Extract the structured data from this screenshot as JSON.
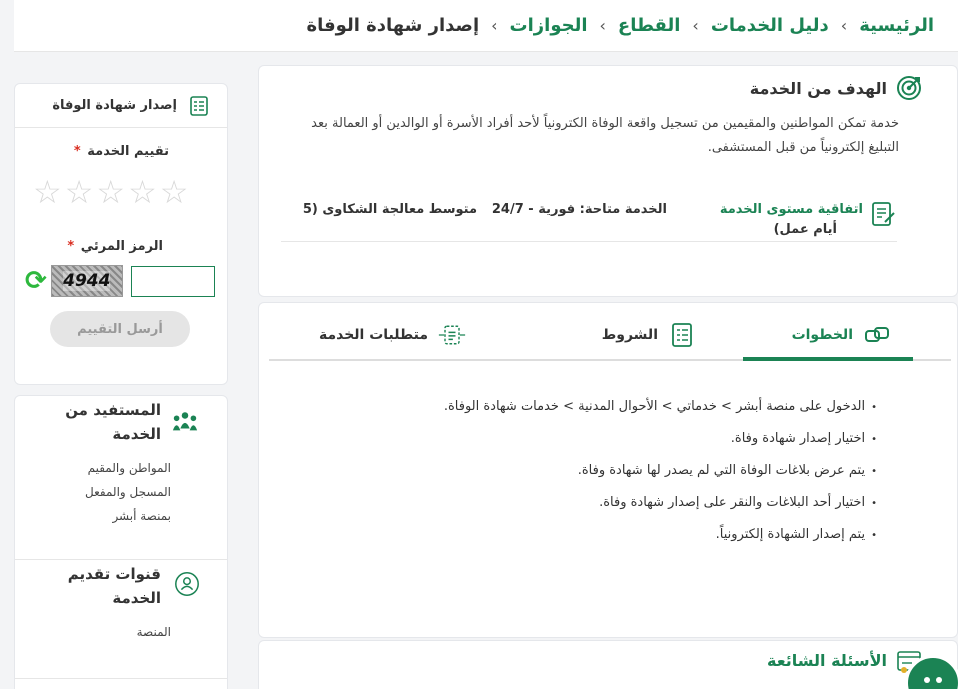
{
  "breadcrumb": {
    "items": [
      "الرئيسية",
      "دليل الخدمات",
      "القطاع",
      "الجوازات",
      "إصدار شهادة الوفاة"
    ],
    "separator": "›"
  },
  "goal": {
    "title": "الهدف من الخدمة",
    "description": "خدمة تمكن المواطنين والمقيمين من تسجيل واقعة الوفاة الكترونياً لأحد أفراد الأسرة أو الوالدين أو العمالة بعد التبليغ إلكترونياً من قبل المستشفى.",
    "sla_title": "اتفاقية مستوى الخدمة",
    "sla_availability": "الخدمة متاحة: فورية - 24/7",
    "sla_avg": "متوسط معالجة الشكاوى (5",
    "sla_days": "أيام عمل)"
  },
  "tabs": {
    "items": [
      {
        "label": "الخطوات",
        "icon": "steps-icon"
      },
      {
        "label": "الشروط",
        "icon": "conditions-icon"
      },
      {
        "label": "متطلبات الخدمة",
        "icon": "requirements-icon"
      }
    ],
    "active_index": 0
  },
  "steps": [
    "الدخول على منصة أبشر > خدماتي > الأحوال المدنية > خدمات شهادة الوفاة.",
    "اختيار إصدار شهادة وفاة.",
    "يتم عرض بلاغات الوفاة التي لم يصدر لها شهادة وفاة.",
    "اختيار أحد البلاغات والنقر على إصدار شهادة وفاة.",
    "يتم إصدار الشهادة إلكترونياً."
  ],
  "faq": {
    "title": "الأسئلة الشائعة"
  },
  "rating": {
    "header": "إصدار شهادة الوفاة",
    "rating_label": "تقييم الخدمة",
    "required_mark": "*",
    "captcha_label": "الرمز المرئي",
    "captcha_text": "4944",
    "captcha_value": "",
    "submit_label": "أرسل التقييم",
    "stars_selected": 0,
    "stars_total": 5
  },
  "beneficiary": {
    "title": "المستفيد من الخدمة",
    "lines": [
      "المواطن والمقيم",
      "المسجل والمفعل",
      "بمنصة أبشر"
    ]
  },
  "channels": {
    "title": "قنوات تقديم الخدمة",
    "value": "المنصة"
  },
  "colors": {
    "accent": "#1b8354",
    "required": "#d92d20",
    "refresh": "#2db83d"
  }
}
